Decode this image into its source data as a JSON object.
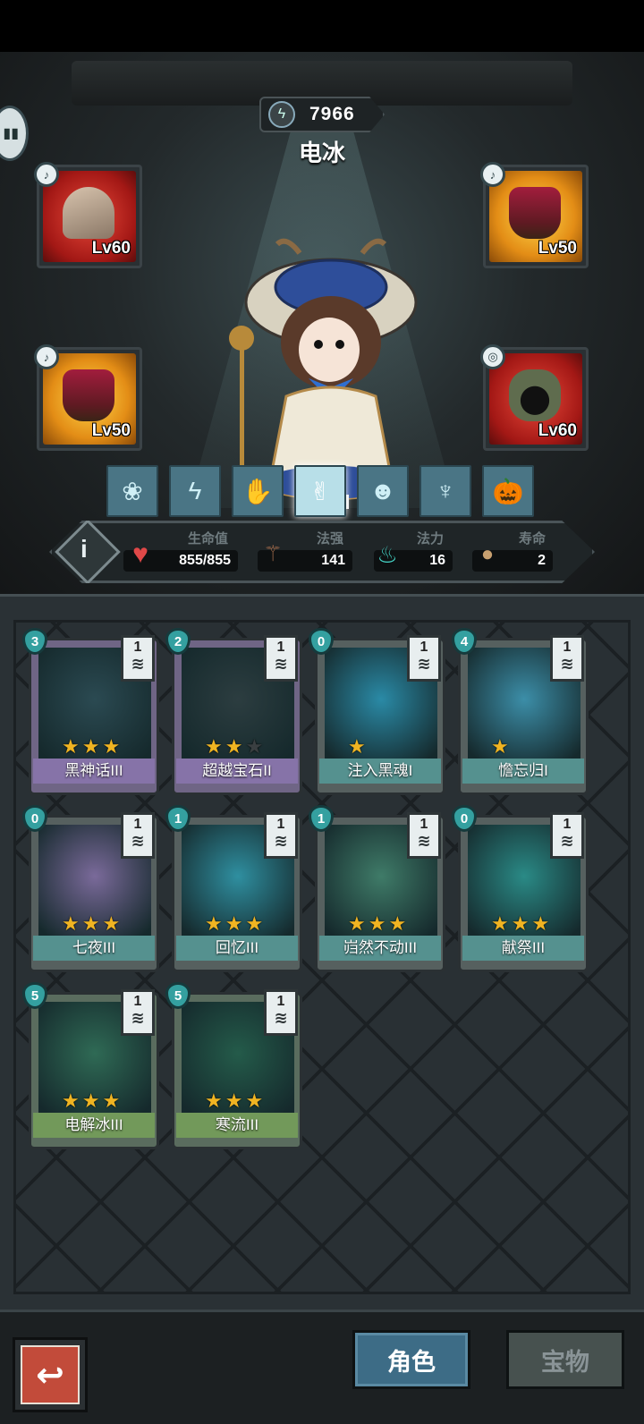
{
  "header": {
    "power": "7966",
    "character_name": "电冰"
  },
  "equipment": [
    {
      "slot": "top-left",
      "badge": "♪",
      "level": "Lv60",
      "tone": "red"
    },
    {
      "slot": "top-right",
      "badge": "♪",
      "level": "Lv50",
      "tone": "gold"
    },
    {
      "slot": "mid-left",
      "badge": "♪",
      "level": "Lv50",
      "tone": "gold"
    },
    {
      "slot": "mid-right",
      "badge": "◎",
      "level": "Lv60",
      "tone": "red"
    }
  ],
  "skill_tabs": [
    "❀",
    "ϟ",
    "✋",
    "✌",
    "☻",
    "♆",
    "🎃"
  ],
  "stats": {
    "hp_label": "生命值",
    "hp_value": "855/855",
    "power_label": "法强",
    "power_value": "141",
    "mana_label": "法力",
    "mana_value": "16",
    "life_label": "寿命",
    "life_value": "2"
  },
  "cards": [
    {
      "name": "黑神话III",
      "cost": "3",
      "count": "1",
      "stars": 3,
      "frame": "purple",
      "art": "#2b4a52"
    },
    {
      "name": "超越宝石II",
      "cost": "2",
      "count": "1",
      "stars": 2,
      "frame": "purple",
      "art": "#2c3d40"
    },
    {
      "name": "注入黑魂I",
      "cost": "0",
      "count": "1",
      "stars": 1,
      "frame": "teal",
      "art": "#2a8aa6"
    },
    {
      "name": "憺忘归I",
      "cost": "4",
      "count": "1",
      "stars": 1,
      "frame": "teal",
      "art": "#3c8ea8"
    },
    {
      "name": "七夜III",
      "cost": "0",
      "count": "1",
      "stars": 3,
      "frame": "teal",
      "art": "#7a6a9a"
    },
    {
      "name": "回忆III",
      "cost": "1",
      "count": "1",
      "stars": 3,
      "frame": "teal",
      "art": "#2f8fa0"
    },
    {
      "name": "岿然不动III",
      "cost": "1",
      "count": "1",
      "stars": 3,
      "frame": "teal",
      "art": "#3f7b68"
    },
    {
      "name": "献祭III",
      "cost": "0",
      "count": "1",
      "stars": 3,
      "frame": "teal",
      "art": "#2a8a86"
    },
    {
      "name": "电解冰III",
      "cost": "5",
      "count": "1",
      "stars": 3,
      "frame": "green",
      "art": "#2f6a55"
    },
    {
      "name": "寒流III",
      "cost": "5",
      "count": "1",
      "stars": 3,
      "frame": "green",
      "art": "#245b4a"
    }
  ],
  "nav": {
    "role_label": "角色",
    "treasure_label": "宝物",
    "back_icon": "↩"
  }
}
